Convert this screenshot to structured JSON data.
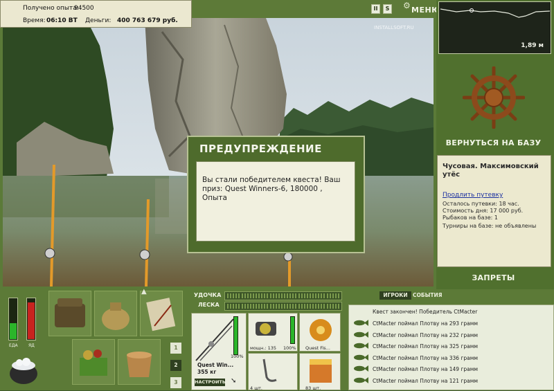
{
  "status": {
    "xp_label": "Получено опыта:",
    "xp_value": "94500",
    "time_label": "Время:",
    "time_value": "06:10 ВТ",
    "money_label": "Деньги:",
    "money_value": "400 763 679 руб."
  },
  "topbar": {
    "menu_label": "МЕНЮ",
    "pause_label": "II",
    "sound_label": "S"
  },
  "watermark": "INSTALLSOFT.RU",
  "depth": {
    "value": "1,89 м"
  },
  "right_panel": {
    "return_label": "ВЕРНУТЬСЯ НА БАЗУ",
    "location_title": "Чусовая. Максимовский утёс",
    "extend_link": "Продлить путевку",
    "lines": [
      "Осталось путевки: 18 час.",
      "Стоимость дня: 17 000 руб.",
      "Рыбаков на базе: 1",
      "Турниры на базе: не объявлены"
    ],
    "bans_label": "ЗАПРЕТЫ"
  },
  "dialog": {
    "title": "ПРЕДУПРЕЖДЕНИЕ",
    "message": "Вы стали победителем квеста! Ваш приз: Quest Winners-6, 180000 , Опыта"
  },
  "meters": {
    "food_label": "ЕДА",
    "poison_label": "ЯД",
    "food_level": 0.4,
    "poison_level": 0.92
  },
  "pages": [
    "1",
    "2",
    "3"
  ],
  "tackle": {
    "rod_label": "УДОЧКА",
    "line_label": "ЛЕСКА",
    "rod_name": "Quest Win...",
    "rod_weight": "355 кг",
    "rod_percent": "100%",
    "reel_power": "мощн.: 135",
    "reel_percent": "100%",
    "line_name": "Quest Fis...",
    "hook_count": "4 шт.",
    "bait_count": "83 шт.",
    "setup_label": "НАСТРОИТЬ"
  },
  "chat": {
    "tabs": [
      "ИГРОКИ",
      "СОБЫТИЯ"
    ],
    "header_line": "Квест закончен! Победитель CtMacter",
    "lines": [
      "CtMacter поймал Плотву на 293 грамм",
      "CtMacter поймал Плотву на 232 грамм",
      "CtMacter поймал Плотву на 325 грамм",
      "CtMacter поймал Плотву на 336 грамм",
      "CtMacter поймал Плотву на 149 грамм",
      "CtMacter поймал Плотву на 121 грамм"
    ]
  },
  "colors": {
    "panel_green": "#5c7a37",
    "cream": "#ece9cf",
    "food_green": "#2bb52a",
    "poison_red": "#c8231f"
  }
}
